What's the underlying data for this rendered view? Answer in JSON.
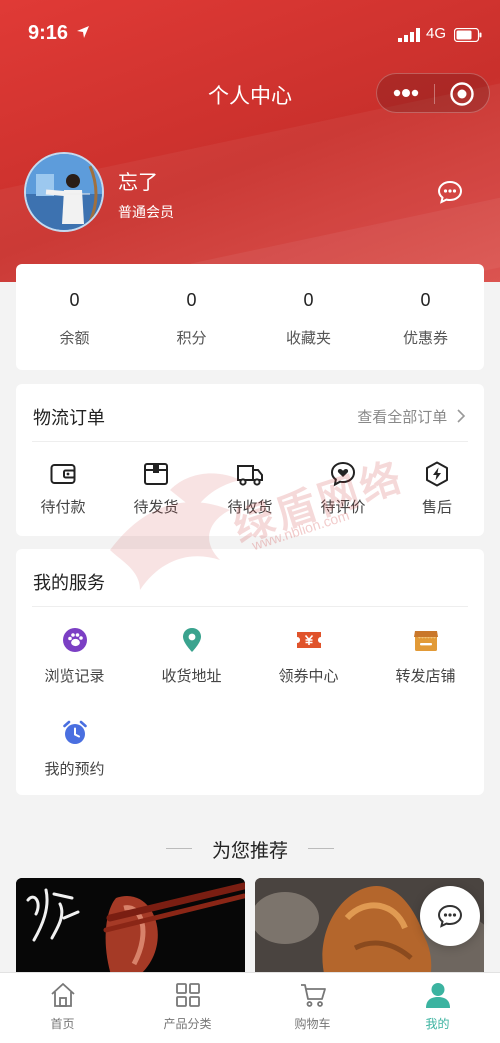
{
  "status_bar": {
    "time": "9:16",
    "network": "4G"
  },
  "nav": {
    "title": "个人中心"
  },
  "profile": {
    "name": "忘了",
    "level": "普通会员"
  },
  "stats": [
    {
      "value": "0",
      "label": "余额"
    },
    {
      "value": "0",
      "label": "积分"
    },
    {
      "value": "0",
      "label": "收藏夹"
    },
    {
      "value": "0",
      "label": "优惠券"
    }
  ],
  "orders": {
    "title": "物流订单",
    "view_all": "查看全部订单",
    "items": [
      {
        "label": "待付款",
        "icon": "wallet-icon"
      },
      {
        "label": "待发货",
        "icon": "package-icon"
      },
      {
        "label": "待收货",
        "icon": "truck-icon"
      },
      {
        "label": "待评价",
        "icon": "heart-chat-icon"
      },
      {
        "label": "售后",
        "icon": "lightning-shield-icon"
      }
    ]
  },
  "services": {
    "title": "我的服务",
    "items": [
      {
        "label": "浏览记录",
        "icon": "footprint-icon",
        "color": "#7b3fc4"
      },
      {
        "label": "收货地址",
        "icon": "location-pin-icon",
        "color": "#3aa38e"
      },
      {
        "label": "领券中心",
        "icon": "coupon-icon",
        "color": "#e0532b"
      },
      {
        "label": "转发店铺",
        "icon": "store-icon",
        "color": "#e29a37"
      },
      {
        "label": "我的预约",
        "icon": "alarm-clock-icon",
        "color": "#4a6fe0"
      }
    ]
  },
  "recommend": {
    "title": "为您推荐"
  },
  "tabbar": [
    {
      "label": "首页",
      "icon": "home-icon"
    },
    {
      "label": "产品分类",
      "icon": "grid-icon"
    },
    {
      "label": "购物车",
      "icon": "cart-icon"
    },
    {
      "label": "我的",
      "icon": "user-icon",
      "active": true
    }
  ],
  "watermark": {
    "text": "绿盾网络",
    "url": "www.nblion.com"
  },
  "colors": {
    "brand": "#d8362f",
    "active_tab": "#3bb3a0"
  }
}
